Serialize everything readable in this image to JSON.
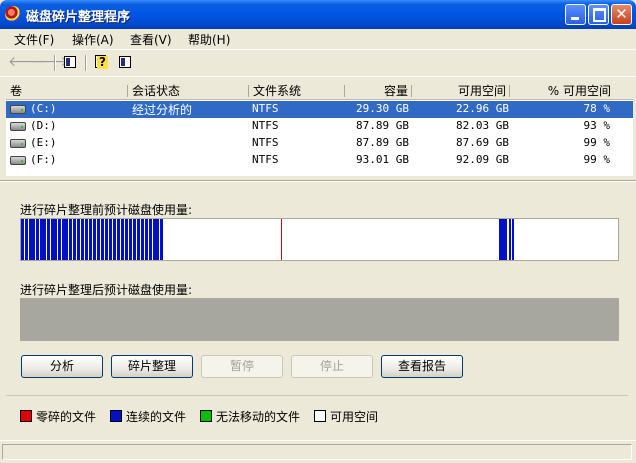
{
  "window": {
    "title": "磁盘碎片整理程序"
  },
  "menu": [
    "文件(F)",
    "操作(A)",
    "查看(V)",
    "帮助(H)"
  ],
  "columns": [
    "卷",
    "会话状态",
    "文件系统",
    "容量",
    "可用空间",
    "% 可用空间"
  ],
  "volumes": [
    {
      "name": "(C:)",
      "status": "经过分析的",
      "fs": "NTFS",
      "capacity": "29.30 GB",
      "free": "22.96 GB",
      "pct": "78 %"
    },
    {
      "name": "(D:)",
      "status": "",
      "fs": "NTFS",
      "capacity": "87.89 GB",
      "free": "82.03 GB",
      "pct": "93 %"
    },
    {
      "name": "(E:)",
      "status": "",
      "fs": "NTFS",
      "capacity": "87.89 GB",
      "free": "87.69 GB",
      "pct": "99 %"
    },
    {
      "name": "(F:)",
      "status": "",
      "fs": "NTFS",
      "capacity": "93.01 GB",
      "free": "92.09 GB",
      "pct": "99 %"
    }
  ],
  "selected_row": 0,
  "before_label": "进行碎片整理前预计磁盘使用量:",
  "after_label": "进行碎片整理后预计磁盘使用量:",
  "buttons": {
    "analyze": "分析",
    "defrag": "碎片整理",
    "pause": "暂停",
    "stop": "停止",
    "report": "查看报告"
  },
  "legend": {
    "fragmented": "零碎的文件",
    "contiguous": "连续的文件",
    "unmovable": "无法移动的文件",
    "free": "可用空间"
  },
  "colors": {
    "fragmented": "#E00000",
    "contiguous": "#0010C8",
    "unmovable": "#00C000",
    "free": "#FFFFFF"
  }
}
